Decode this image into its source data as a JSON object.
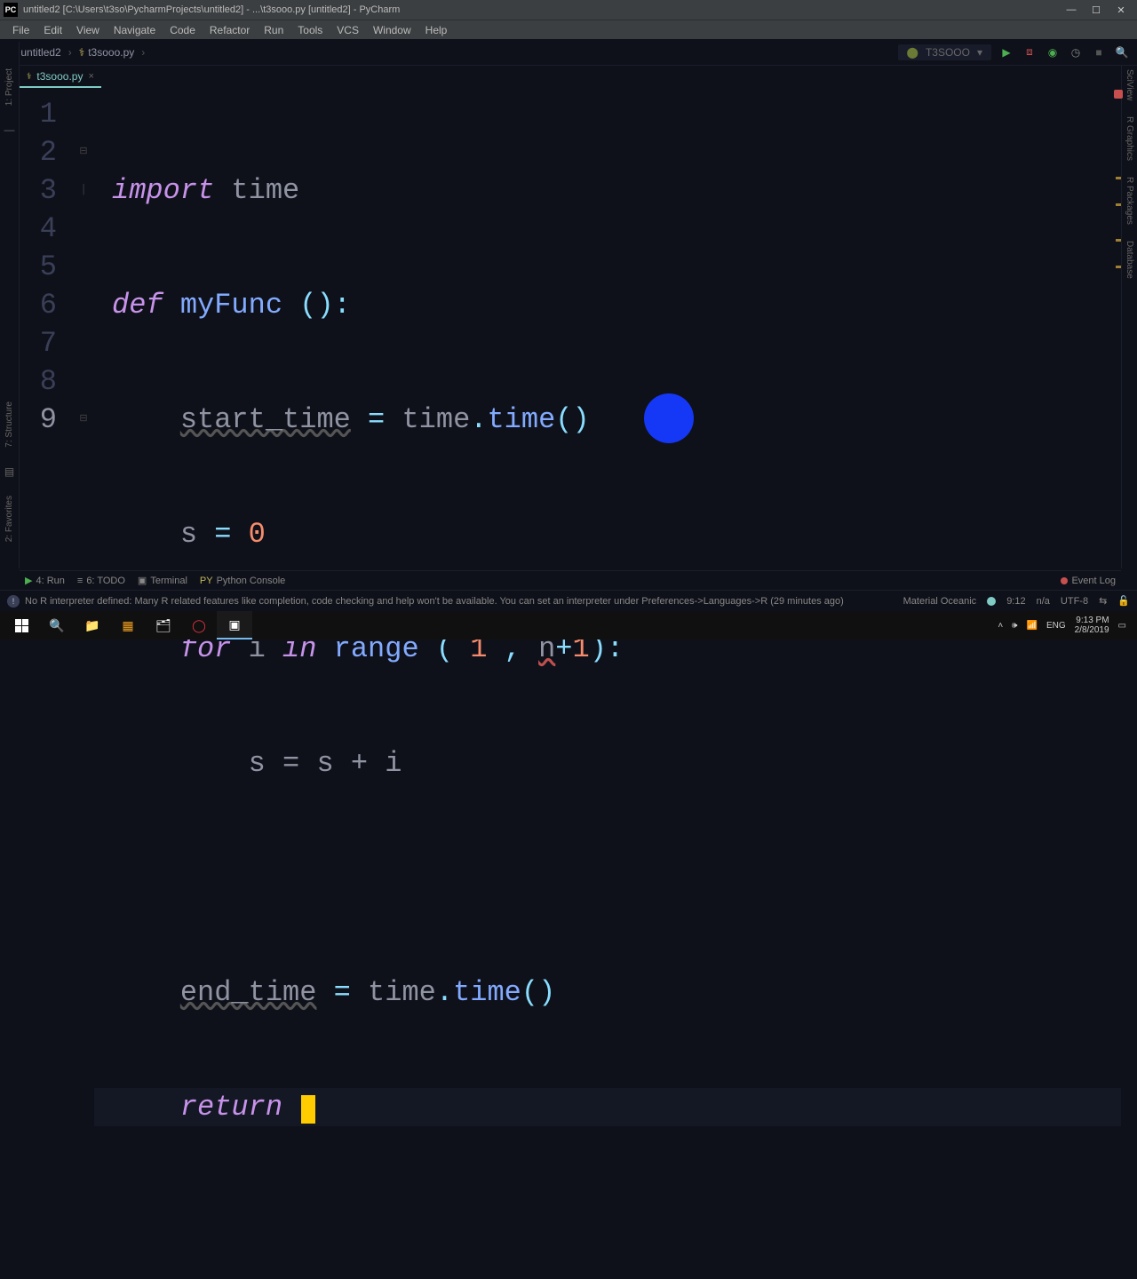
{
  "titlebar": {
    "app_icon": "PC",
    "title": "untitled2 [C:\\Users\\t3so\\PycharmProjects\\untitled2] - ...\\t3sooo.py [untitled2] - PyCharm"
  },
  "menu": [
    "File",
    "Edit",
    "View",
    "Navigate",
    "Code",
    "Refactor",
    "Run",
    "Tools",
    "VCS",
    "Window",
    "Help"
  ],
  "breadcrumb": {
    "project": "untitled2",
    "file": "t3sooo.py"
  },
  "run_config": {
    "name": "T3SOOO"
  },
  "tab": {
    "filename": "t3sooo.py"
  },
  "code": {
    "lines": [
      "1",
      "2",
      "3",
      "4",
      "5",
      "6",
      "7",
      "8",
      "9"
    ],
    "l1": {
      "kw": "import",
      "mod": "time"
    },
    "l2": {
      "kw": "def",
      "name": "myFunc",
      "paren": " ():"
    },
    "l3": {
      "var": "start_time",
      "eq": " = ",
      "obj": "time",
      "dot": ".",
      "call": "time",
      "paren": "()"
    },
    "l4": {
      "var": "s",
      "eq": " = ",
      "num": "0"
    },
    "l5": {
      "kw1": "for",
      "i": "i",
      "kw2": "in",
      "fn": "range",
      "open": " ( ",
      "n1": "1",
      "comma": " , ",
      "n": "n",
      "plus": "+",
      "n2": "1",
      "close": "):"
    },
    "l6": {
      "txt": "s = s + i"
    },
    "l8": {
      "var": "end_time",
      "eq": " = ",
      "obj": "time",
      "dot": ".",
      "call": "time",
      "paren": "()"
    },
    "l9": {
      "kw": "return"
    }
  },
  "bottom": {
    "run": "4: Run",
    "todo": "6: TODO",
    "terminal": "Terminal",
    "pyconsole": "Python Console",
    "eventlog": "Event Log"
  },
  "status": {
    "msg": "No R interpreter defined: Many R related features like completion, code checking and help won't be available. You can set an interpreter under Preferences->Languages->R (29 minutes ago)",
    "theme": "Material Oceanic",
    "pos": "9:12",
    "sel": "n/a",
    "enc": "UTF-8",
    "lock": "🔓"
  },
  "left_tools": {
    "project": "1: Project",
    "structure": "7: Structure",
    "favorites": "2: Favorites"
  },
  "right_tools": {
    "sciview": "SciView",
    "rgraphics": "R Graphics",
    "rpackages": "R Packages",
    "database": "Database"
  },
  "taskbar": {
    "lang": "ENG",
    "time": "9:13 PM",
    "date": "2/8/2019"
  }
}
